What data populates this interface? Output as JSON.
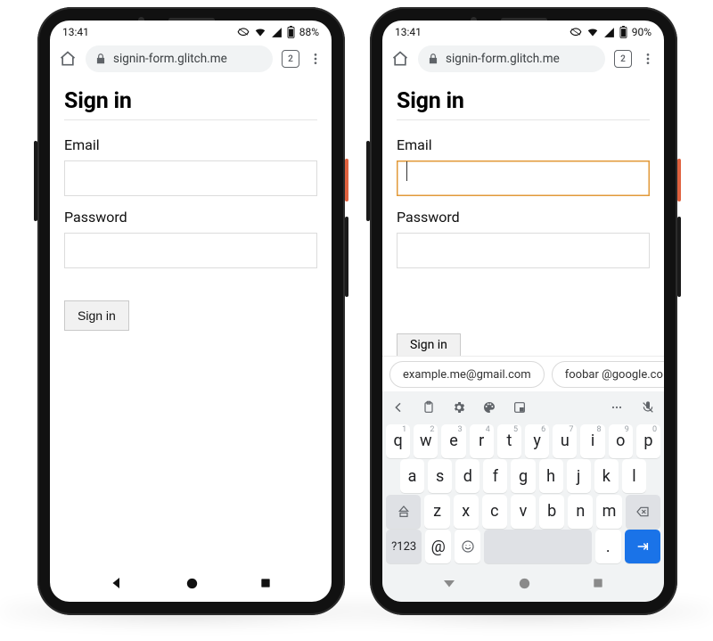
{
  "status": {
    "time": "13:41",
    "battery_left": "88%",
    "battery_right": "90%"
  },
  "browser": {
    "url": "signin-form.glitch.me",
    "tabs_count": "2"
  },
  "page": {
    "title": "Sign in",
    "email_label": "Email",
    "password_label": "Password",
    "submit_label": "Sign in"
  },
  "suggestions": {
    "s1": "example.me@gmail.com",
    "s2": "foobar @google.co"
  },
  "keys": {
    "r1": [
      "q",
      "w",
      "e",
      "r",
      "t",
      "y",
      "u",
      "i",
      "o",
      "p"
    ],
    "sup1": [
      "1",
      "2",
      "3",
      "4",
      "5",
      "6",
      "7",
      "8",
      "9",
      "0"
    ],
    "r2": [
      "a",
      "s",
      "d",
      "f",
      "g",
      "h",
      "j",
      "k",
      "l"
    ],
    "r3": [
      "z",
      "x",
      "c",
      "v",
      "b",
      "n",
      "m"
    ],
    "sym": "?123",
    "at": "@",
    "dot": "."
  }
}
